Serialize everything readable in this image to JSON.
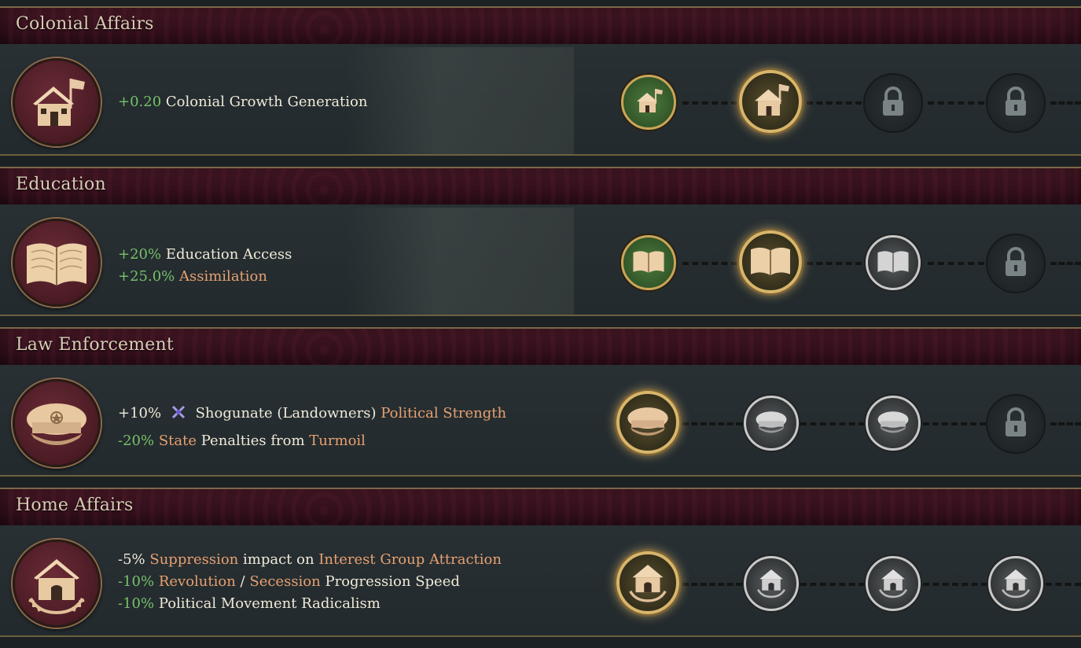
{
  "sections": [
    {
      "title": "Colonial Affairs",
      "modifiers": [
        {
          "value": "+0.20",
          "label": "Colonial Growth Generation"
        }
      ]
    },
    {
      "title": "Education",
      "modifiers": [
        {
          "value": "+20%",
          "label": "Education Access"
        },
        {
          "value": "+25.0%",
          "label": "Assimilation"
        }
      ]
    },
    {
      "title": "Law Enforcement",
      "modifiers": [
        {
          "value": "+10%",
          "label_a": "Shogunate (Landowners)",
          "label_b": "Political Strength"
        },
        {
          "value": "-20%",
          "label_a": "State",
          "label_b": "Penalties from",
          "label_c": "Turmoil"
        }
      ]
    },
    {
      "title": "Home Affairs",
      "modifiers": [
        {
          "value": "-5%",
          "label_a": "Suppression",
          "label_b": "impact on",
          "label_c": "Interest Group Attraction"
        },
        {
          "value": "-10%",
          "label_a": "Revolution",
          "label_b": "/",
          "label_c": "Secession",
          "label_d": "Progression Speed"
        },
        {
          "value": "-10%",
          "label_a": "Political Movement Radicalism"
        }
      ]
    }
  ],
  "colors": {
    "positive": "#77c06a",
    "highlight": "#e8a070",
    "header_bg": "#3a1220",
    "panel_bg": "#252d30",
    "gold": "#d8b56a"
  },
  "icons": {
    "colonial": "house-with-flag-icon",
    "education": "open-book-icon",
    "law": "police-cap-icon",
    "home": "house-with-laurel-icon",
    "lock": "padlock-icon",
    "ig": "crossed-swords-icon"
  }
}
